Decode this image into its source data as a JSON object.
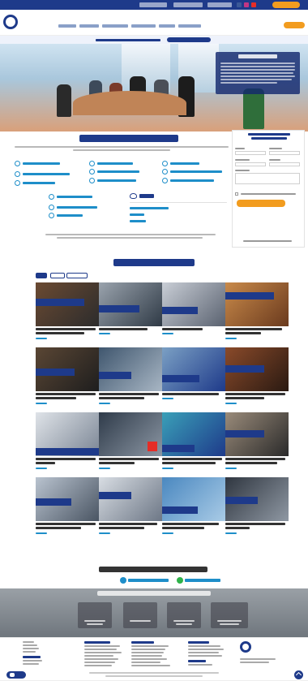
{
  "page": {
    "top_bar": {
      "email": "",
      "contact_label": "",
      "call_label": "",
      "cta_label": ""
    },
    "header": {
      "brand_line1": "",
      "brand_line2": "",
      "brand_line3": "",
      "nav_items": [
        "",
        "",
        "",
        "",
        "",
        ""
      ],
      "cta_label": ""
    },
    "strip": {
      "text": "",
      "button_label": ""
    },
    "hero": {
      "title": "",
      "box_title": "",
      "box_lines": [
        "",
        "",
        "",
        "",
        ""
      ]
    },
    "formacion": {
      "title": "",
      "intro": "",
      "left_links": [
        "",
        "",
        ""
      ],
      "middle_links": [
        "",
        "",
        ""
      ],
      "right_links": [
        "",
        "",
        ""
      ],
      "lower_left_links": [
        "",
        "",
        ""
      ],
      "category_title": "",
      "category_links": [
        "",
        "",
        ""
      ],
      "note": ""
    },
    "form": {
      "title": "",
      "fields": [
        "",
        "",
        "",
        "",
        "",
        ""
      ],
      "privacy_note": "",
      "submit_label": "",
      "footer_note": ""
    },
    "oferta": {
      "title": "",
      "tabs": [
        "",
        "",
        ""
      ],
      "cards": [
        {
          "title": "",
          "more": ""
        },
        {
          "title": "",
          "more": ""
        },
        {
          "title": "",
          "more": ""
        },
        {
          "title": "",
          "more": ""
        },
        {
          "title": "",
          "more": ""
        },
        {
          "title": "",
          "more": ""
        },
        {
          "title": "",
          "more": ""
        },
        {
          "title": "",
          "more": ""
        },
        {
          "title": "",
          "more": ""
        },
        {
          "title": "",
          "more": ""
        },
        {
          "title": "",
          "more": ""
        },
        {
          "title": "",
          "more": ""
        },
        {
          "title": "",
          "more": ""
        },
        {
          "title": "",
          "more": ""
        },
        {
          "title": "",
          "more": ""
        },
        {
          "title": "",
          "more": ""
        }
      ]
    },
    "contacto": {
      "title": "",
      "email": "",
      "whatsapp": ""
    },
    "stats": {
      "title": "",
      "items": [
        {
          "value": "",
          "label": ""
        },
        {
          "value": "",
          "label": ""
        },
        {
          "value": "",
          "label": ""
        },
        {
          "value": "",
          "label": ""
        }
      ]
    },
    "footer": {
      "brand_line1": "",
      "brand_line2": "",
      "brand_line3": "",
      "copyright": ""
    }
  },
  "colors": {
    "brand_blue": "#1e3a8a",
    "link_blue": "#1e8ec9",
    "accent_orange": "#f29c1f",
    "facebook": "#3b5998",
    "instagram": "#c13584",
    "youtube": "#e52d27"
  },
  "icons": [
    "facebook-icon",
    "instagram-icon",
    "youtube-icon",
    "email-icon",
    "whatsapp-icon",
    "health-icon",
    "chat-icon",
    "arrow-up-icon"
  ]
}
